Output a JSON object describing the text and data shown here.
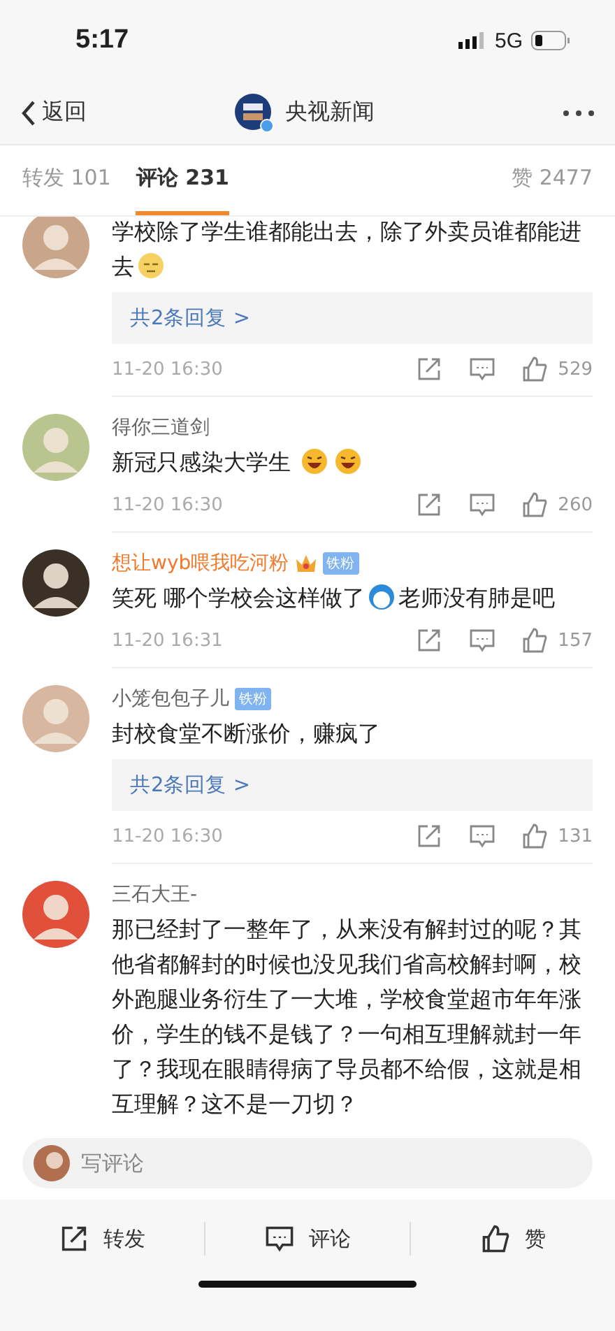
{
  "status_bar": {
    "time": "5:17",
    "network": "5G"
  },
  "nav": {
    "back": "返回",
    "title": "央视新闻"
  },
  "tabs": [
    {
      "label": "转发 101",
      "selected": false
    },
    {
      "label": "评论 231",
      "selected": true
    }
  ],
  "likes_tab": "赞 2477",
  "comments": [
    {
      "parts": [
        {
          "kind": "text",
          "text": "学校除了学生谁都能出去，除了外卖员谁都能进去"
        },
        {
          "kind": "smirk"
        }
      ],
      "replies": "共2条回复 >",
      "time": "11-20 16:30",
      "likes": "529"
    },
    {
      "name": "得你三道剑",
      "vip": false,
      "parts": [
        {
          "kind": "text",
          "text": "新冠只感染大学生 "
        },
        {
          "kind": "laugh"
        },
        {
          "kind": "laugh"
        }
      ],
      "time": "11-20 16:30",
      "likes": "260"
    },
    {
      "name": "想让wyb喂我吃河粉",
      "vip": true,
      "badge": "铁粉",
      "parts": [
        {
          "kind": "text",
          "text": "笑死 哪个学校会这样做了"
        },
        {
          "kind": "cartoon"
        },
        {
          "kind": "text",
          "text": "老师没有肺是吧"
        }
      ],
      "time": "11-20 16:31",
      "likes": "157"
    },
    {
      "name": "小笼包包子儿",
      "vip": false,
      "badge": "铁粉",
      "parts": [
        {
          "kind": "text",
          "text": "封校食堂不断涨价，赚疯了"
        }
      ],
      "replies": "共2条回复 >",
      "time": "11-20 16:30",
      "likes": "131"
    },
    {
      "name": "三石大王-",
      "vip": false,
      "parts": [
        {
          "kind": "text",
          "text": "那已经封了一整年了，从来没有解封过的呢？其他省都解封的时候也没见我们省高校解封啊，校外跑腿业务衍生了一大堆，学校食堂超市年年涨价，学生的钱不是钱了？一句相互理解就封一年了？我现在眼睛得病了导员都不给假，这就是相互理解？这不是一刀切？"
        }
      ]
    }
  ],
  "composer": {
    "placeholder": "写评论"
  },
  "actions": [
    {
      "kind": "share",
      "label": "转发"
    },
    {
      "kind": "comment",
      "label": "评论"
    },
    {
      "kind": "like",
      "label": "赞"
    }
  ]
}
